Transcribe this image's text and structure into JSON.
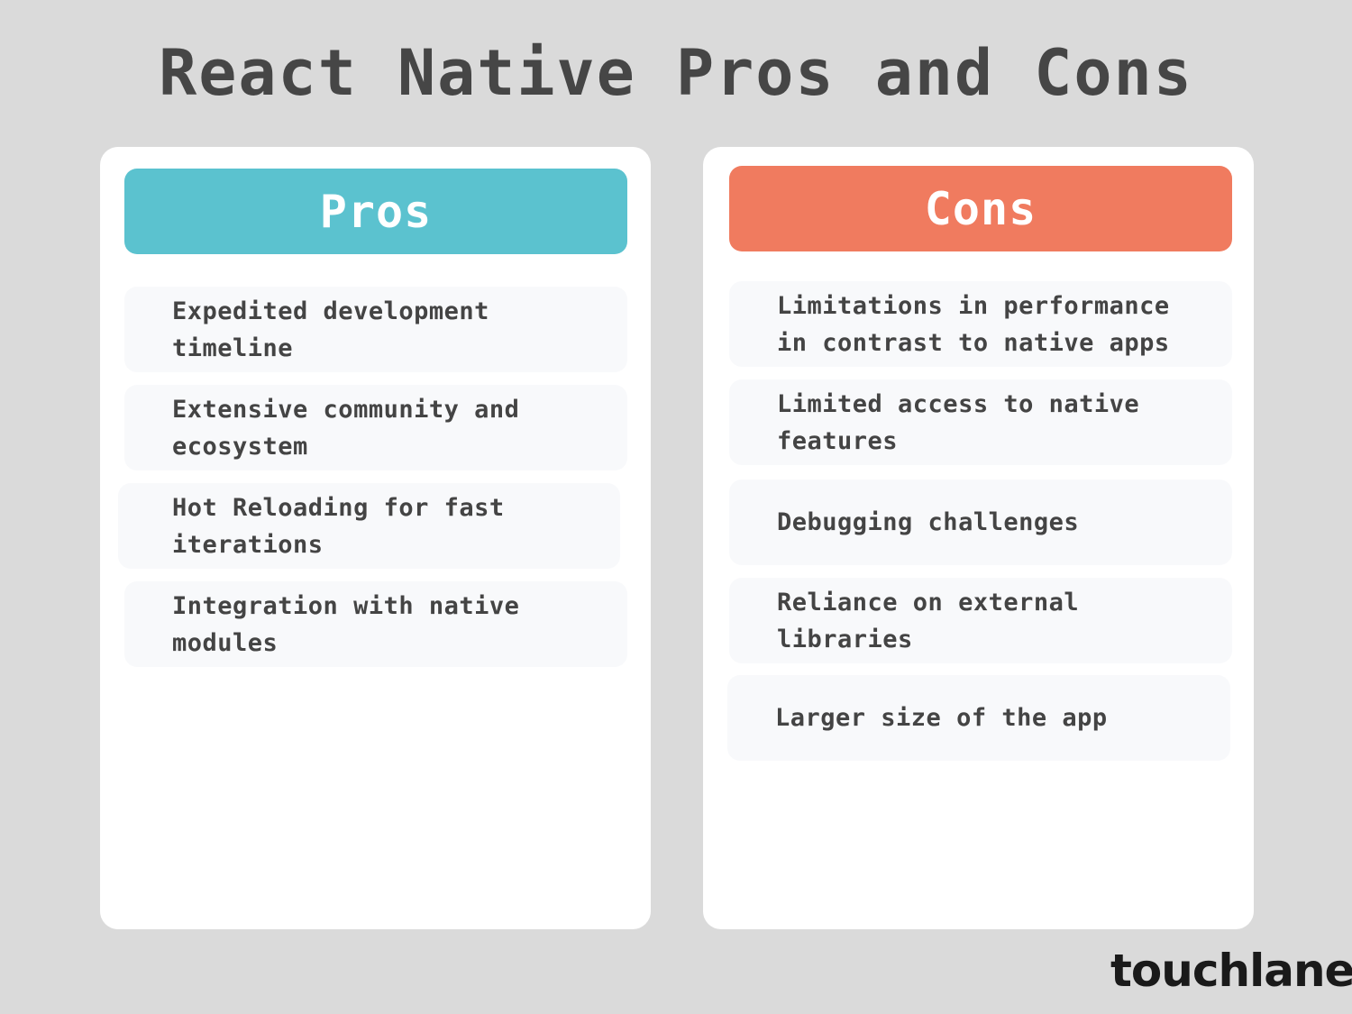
{
  "title": "React Native Pros and Cons",
  "colors": {
    "pros": "#5bc2cf",
    "cons": "#f07b5f"
  },
  "pros": {
    "label": "Pros",
    "items": [
      "Expedited development timeline",
      "Extensive community and ecosystem",
      "Hot Reloading for fast iterations",
      "Integration with native modules"
    ]
  },
  "cons": {
    "label": "Cons",
    "items": [
      "Limitations in performance in contrast to native apps",
      "Limited access to native features",
      "Debugging challenges",
      "Reliance on external libraries",
      "Larger size of the app"
    ]
  },
  "brand": "touchlane"
}
